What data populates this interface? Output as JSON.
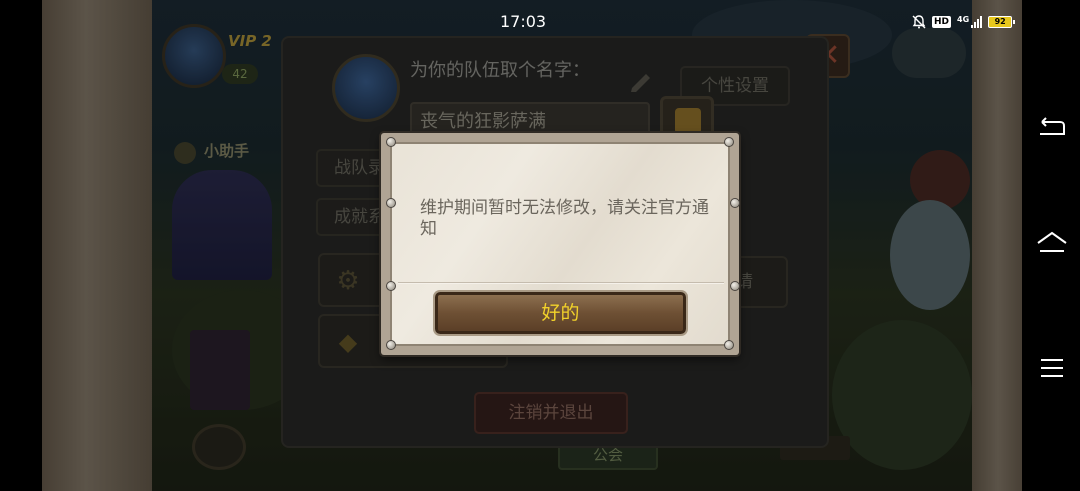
{
  "status_bar": {
    "time": "17:03",
    "hd_label": "HD",
    "network_label": "4G",
    "battery_level": "92"
  },
  "game": {
    "vip_label": "VIP 2",
    "level": "42",
    "helper_label": "小助手",
    "guild_tab": "公会"
  },
  "settings_panel": {
    "name_prompt": "为你的队伍取个名字：",
    "name_value": "丧气的狂影萨满",
    "personal_settings": "个性设置",
    "side_buttons": [
      "战队录",
      "成就系"
    ],
    "right_partial": "请",
    "logout_button": "注销并退出"
  },
  "dialog": {
    "message": "维护期间暂时无法修改，请关注官方通知",
    "ok_button": "好的"
  },
  "colors": {
    "ok_text": "#f2d22a",
    "dialog_bg": "#ece6da",
    "ok_button_bg": "#6e5034"
  }
}
